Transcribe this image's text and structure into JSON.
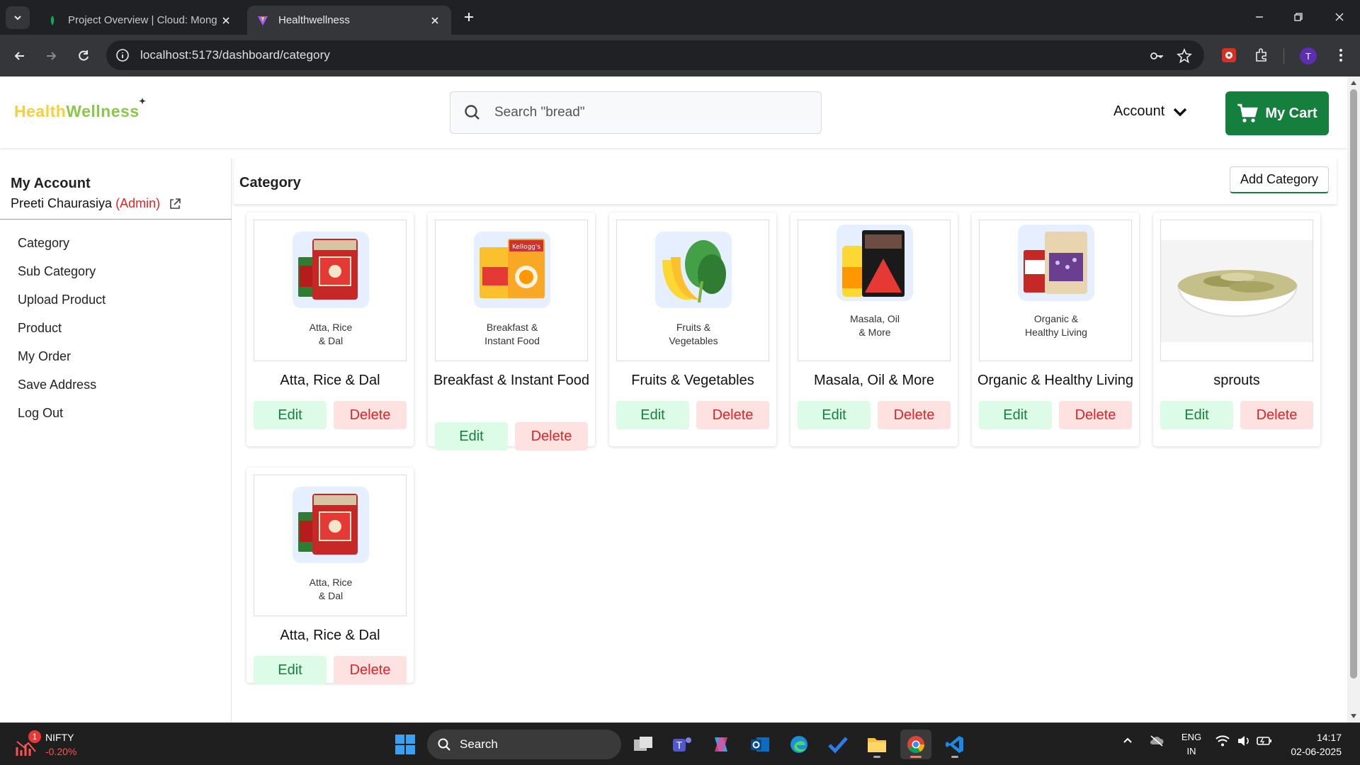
{
  "browser": {
    "tabs": [
      {
        "title": "Project Overview | Cloud: Mong",
        "active": false
      },
      {
        "title": "Healthwellness",
        "active": true
      }
    ],
    "url": "localhost:5173/dashboard/category",
    "profile_initial": "T"
  },
  "header": {
    "logo_part1": "Health",
    "logo_part2": "Wellness",
    "search_placeholder": "Search \"bread\"",
    "account_label": "Account",
    "cart_label": "My Cart"
  },
  "sidebar": {
    "title": "My Account",
    "user_name": "Preeti Chaurasiya",
    "user_role": "(Admin)",
    "items": [
      {
        "label": "Category"
      },
      {
        "label": "Sub Category"
      },
      {
        "label": "Upload Product"
      },
      {
        "label": "Product"
      },
      {
        "label": "My Order"
      },
      {
        "label": "Save Address"
      },
      {
        "label": "Log Out"
      }
    ]
  },
  "content": {
    "title": "Category",
    "add_button": "Add Category",
    "edit_label": "Edit",
    "delete_label": "Delete",
    "categories": [
      {
        "name": "Atta, Rice & Dal",
        "caption_line1": "Atta, Rice",
        "caption_line2": "& Dal"
      },
      {
        "name": "Breakfast & Instant Food",
        "caption_line1": "Breakfast &",
        "caption_line2": "Instant Food"
      },
      {
        "name": "Fruits & Vegetables",
        "caption_line1": "Fruits &",
        "caption_line2": "Vegetables"
      },
      {
        "name": "Masala, Oil & More",
        "caption_line1": "Masala, Oil",
        "caption_line2": "& More"
      },
      {
        "name": "Organic & Healthy Living",
        "caption_line1": "Organic &",
        "caption_line2": "Healthy Living"
      },
      {
        "name": "sprouts",
        "caption_line1": "",
        "caption_line2": ""
      },
      {
        "name": "Atta, Rice & Dal",
        "caption_line1": "Atta, Rice",
        "caption_line2": "& Dal"
      }
    ]
  },
  "taskbar": {
    "widget_name": "NIFTY",
    "widget_change": "-0.20%",
    "widget_badge": "1",
    "search_label": "Search",
    "lang_line1": "ENG",
    "lang_line2": "IN",
    "time": "14:17",
    "date": "02-06-2025"
  },
  "colors": {
    "brand_green": "#15803d",
    "edit_bg": "#dcfce7",
    "delete_bg": "#fee2e2",
    "admin_red": "#dc2626"
  }
}
